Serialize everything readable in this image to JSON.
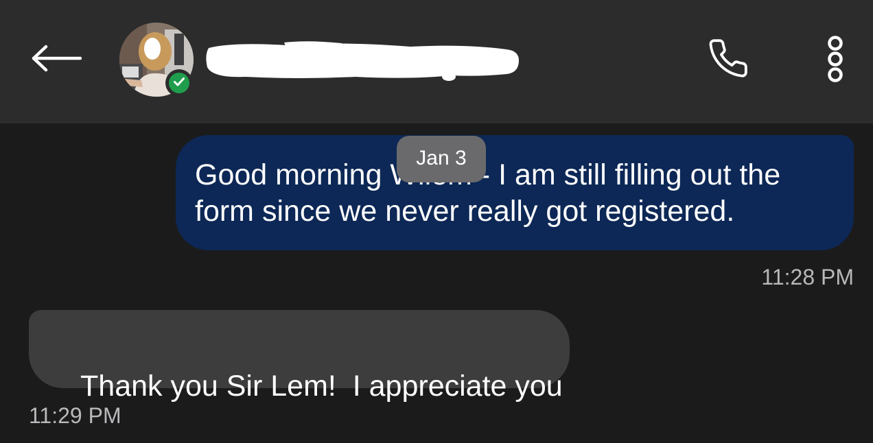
{
  "header": {
    "back_icon": "arrow-left-icon",
    "contact_name_redacted": true,
    "verified_icon": "check-circle-icon",
    "call_icon": "phone-icon",
    "more_icon": "more-vertical-icon"
  },
  "date_chip": "Jan 3",
  "messages": [
    {
      "direction": "outgoing",
      "text": "Good morning Wilem - I am still filling out the form since we never really got registered.",
      "time": "11:28 PM"
    },
    {
      "direction": "incoming",
      "text": "Thank you Sir Lem!  I appreciate you",
      "time": "11:29 PM"
    }
  ],
  "colors": {
    "background": "#1b1b1c",
    "header": "#2c2c2d",
    "outgoing_bubble": "#0d2856",
    "incoming_bubble": "#3d3d3e",
    "verified_badge": "#1f9d4c",
    "timestamp": "#b9b9bb"
  }
}
